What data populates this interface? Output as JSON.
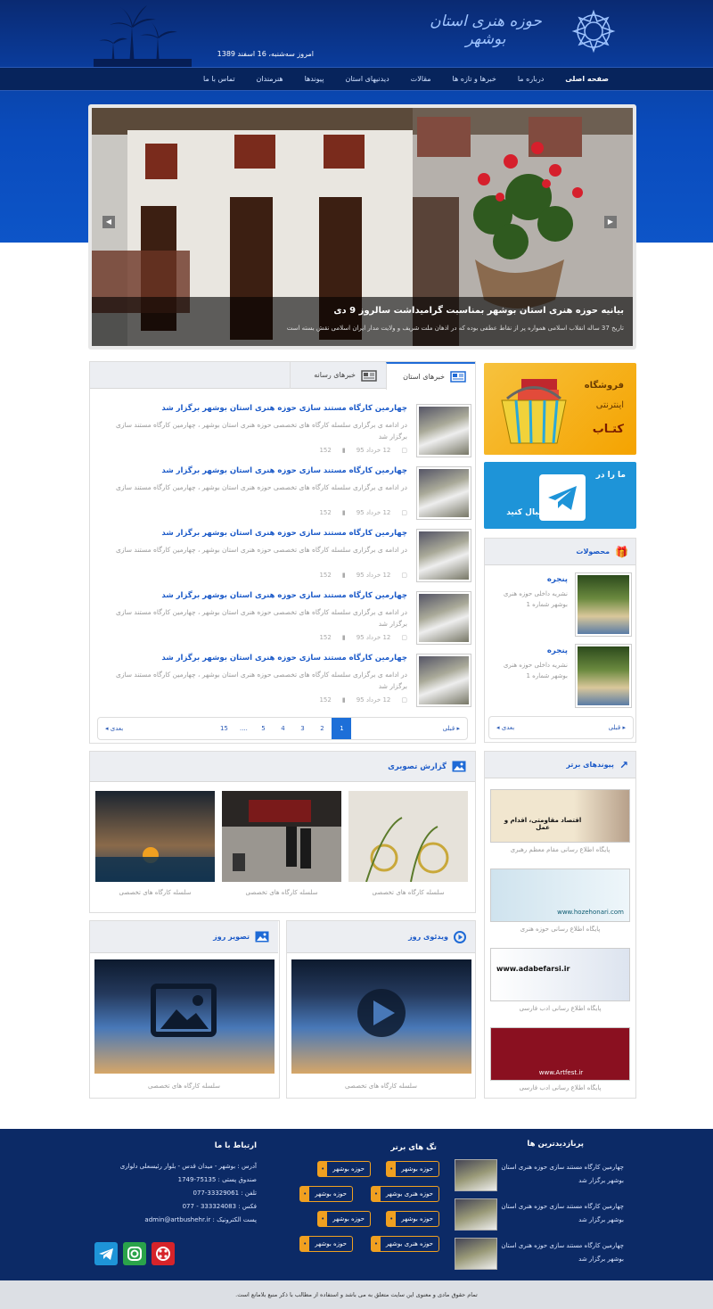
{
  "header": {
    "site_title": "حوزه هنری استان بوشهر",
    "date_line": "امروز سه‌شنبه، 16 اسفند 1389"
  },
  "nav": {
    "items": [
      "صفحه اصلی",
      "درباره ما",
      "خبرها و تازه ها",
      "مقالات",
      "دیدنیهای استان",
      "پیوندها",
      "هنرمندان",
      "تماس با ما"
    ]
  },
  "slider": {
    "title": "بیانیه حوزه هنری استان بوشهر بمناسبت گرامیداشت سالروز 9 دی",
    "summary": "تاریخ 37 ساله انقلاب اسلامی همواره پر از نقاط عطفی بوده که در اذهان ملت شریف و ولایت مدار ایران اسلامی نقش بسته است"
  },
  "news": {
    "tabs": [
      "خبرهای استان",
      "خبرهای رسانه"
    ],
    "items": [
      {
        "title": "چهارمین کارگاه مستند سازی حوزه هنری استان بوشهر برگزار شد",
        "summary": "در ادامه ی برگزاری سلسله کارگاه های تخصصی حوزه هنری استان بوشهر ، چهارمین کارگاه مستند سازی برگزار شد",
        "date": "12 خرداد 95",
        "views": "152"
      },
      {
        "title": "چهارمین کارگاه مستند سازی حوزه هنری استان بوشهر برگزار شد",
        "summary": "در ادامه ی برگزاری سلسله کارگاه های تخصصی حوزه هنری استان بوشهر ، چهارمین کارگاه مستند سازی",
        "date": "12 خرداد 95",
        "views": "152"
      },
      {
        "title": "چهارمین کارگاه مستند سازی حوزه هنری استان بوشهر برگزار شد",
        "summary": "در ادامه ی برگزاری سلسله کارگاه های تخصصی حوزه هنری استان بوشهر ، چهارمین کارگاه مستند سازی",
        "date": "12 خرداد 95",
        "views": "152"
      },
      {
        "title": "چهارمین کارگاه مستند سازی حوزه هنری استان بوشهر برگزار شد",
        "summary": "در ادامه ی برگزاری سلسله کارگاه های تخصصی حوزه هنری استان بوشهر ، چهارمین کارگاه مستند سازی برگزار شد",
        "date": "12 خرداد 95",
        "views": "152"
      },
      {
        "title": "چهارمین کارگاه مستند سازی حوزه هنری استان بوشهر برگزار شد",
        "summary": "در ادامه ی برگزاری سلسله کارگاه های تخصصی حوزه هنری استان بوشهر ، چهارمین کارگاه مستند سازی برگزار شد",
        "date": "12 خرداد 95",
        "views": "152"
      }
    ],
    "pager": {
      "prev": "قبلی",
      "next": "بعدی",
      "pages": [
        "1",
        "2",
        "3",
        "4",
        "5",
        "....",
        "15"
      ],
      "current": "1"
    }
  },
  "ads": {
    "book": {
      "line1": "فروشگاه",
      "line2": "اینترنتی",
      "line3": "کتـاب"
    },
    "telegram": {
      "line1": "ما را در",
      "line2": "دنبال کنید"
    }
  },
  "products": {
    "heading": "محصولات",
    "items": [
      {
        "title": "پنجره",
        "sub": "نشریه داخلی حوزه هنری بوشهر شماره 1"
      },
      {
        "title": "پنجره",
        "sub": "نشریه داخلی حوزه هنری بوشهر شماره 1"
      }
    ],
    "pager": {
      "prev": "قبلی",
      "next": "بعدی"
    }
  },
  "gallery": {
    "heading": "گزارش تصویری",
    "items": [
      {
        "caption": "سلسله کارگاه های تخصصی"
      },
      {
        "caption": "سلسله کارگاه های تخصصی"
      },
      {
        "caption": "سلسله کارگاه های تخصصی"
      }
    ]
  },
  "video": {
    "heading": "ویدئوی روز",
    "caption": "سلسله کارگاه های تخصصی"
  },
  "photo": {
    "heading": "تصویر روز",
    "caption": "سلسله کارگاه های تخصصی"
  },
  "links": {
    "heading": "پیوندهای برتر",
    "items": [
      {
        "caption": "پایگاه اطلاع رسانی مقام معظم رهبری",
        "img_text": "اقتصاد مقاومتی، اقدام و عمل"
      },
      {
        "caption": "پایگاه اطلاع رسانی حوزه هنری",
        "img_text": "www.hozehonari.com"
      },
      {
        "caption": "پایگاه اطلاع رسانی ادب فارسی",
        "img_text": "www.adabefarsi.ir"
      },
      {
        "caption": "پایگاه اطلاع رسانی ادب فارسی",
        "img_text": "www.Artfest.ir"
      }
    ]
  },
  "footer": {
    "popular_heading": "پربازدیدترین ها",
    "popular": [
      "چهارمین کارگاه مستند سازی حوزه هنری استان بوشهر برگزار شد",
      "چهارمین کارگاه مستند سازی حوزه هنری استان بوشهر برگزار شد",
      "چهارمین کارگاه مستند سازی حوزه هنری استان بوشهر برگزار شد"
    ],
    "tags_heading": "تگ های برتر",
    "tags": [
      "حوزه بوشهر",
      "حوزه بوشهر",
      "حوزه هنری بوشهر",
      "حوزه بوشهر",
      "حوزه بوشهر",
      "حوزه بوشهر",
      "حوزه هنری بوشهر",
      "حوزه بوشهر"
    ],
    "contact_heading": "ارتباط با ما",
    "contact": [
      "آدرس : بوشهر - میدان قدس - بلوار رئیسعلی دلواری",
      "صندوق پستی : 75135-1749",
      "تلفن : 33329061-077",
      "فکس : 333324083 - 077",
      "پست الکترونیک : admin@artbushehr.ir"
    ],
    "copyright": "تمام حقوق مادی و معنوی این سایت متعلق به می باشد و استفاده از مطالب با ذکر منبع بلامانع است."
  }
}
